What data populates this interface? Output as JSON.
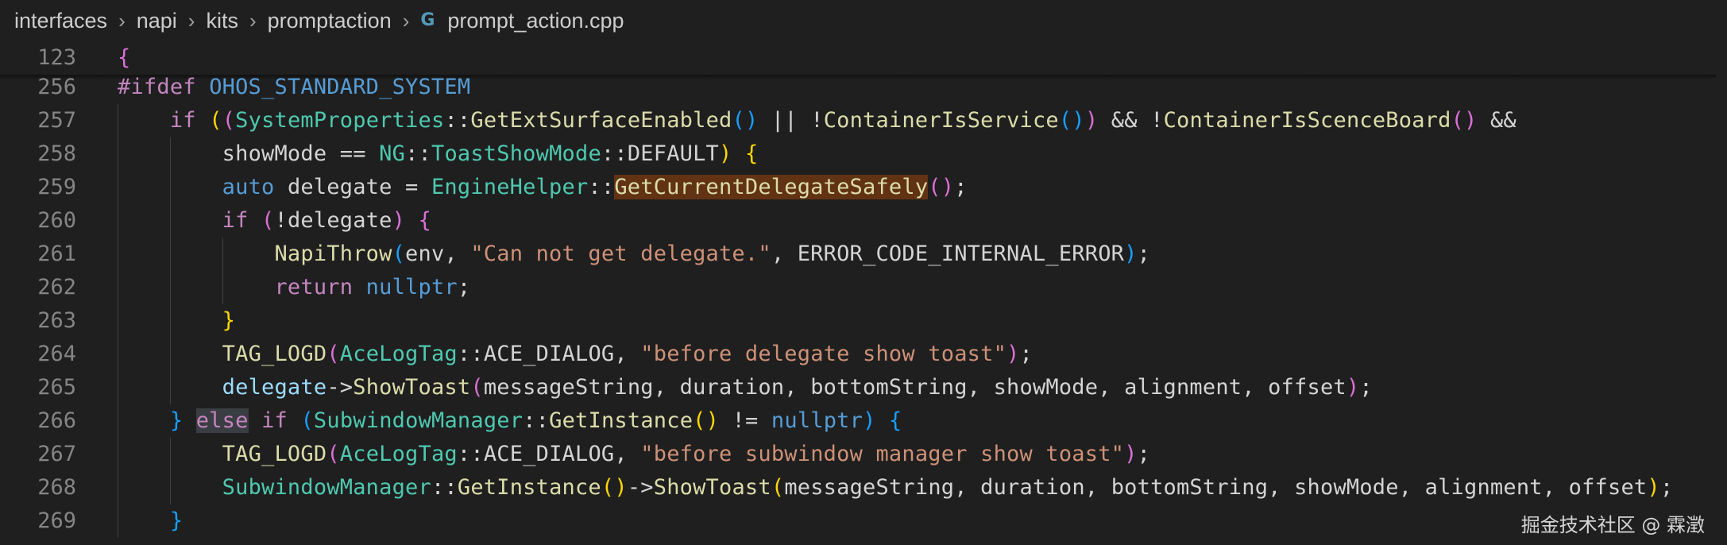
{
  "breadcrumb": {
    "parts": [
      "interfaces",
      "napi",
      "kits",
      "promptaction"
    ],
    "file_icon": "C-plus-plus-file-icon",
    "file": "prompt_action.cpp"
  },
  "sticky": {
    "lineno": "123",
    "text": "{"
  },
  "lines": [
    {
      "n": "256",
      "tokens": [
        [
          "#ifdef",
          "kw"
        ],
        [
          " OHOS_STANDARD_SYSTEM",
          "macro"
        ]
      ]
    },
    {
      "n": "257",
      "tokens": [
        [
          "    ",
          "plain"
        ],
        [
          "if",
          "kw"
        ],
        [
          " ",
          "plain"
        ],
        [
          "(",
          "br1"
        ],
        [
          "(",
          "br2"
        ],
        [
          "SystemProperties",
          "type"
        ],
        [
          "::",
          "op"
        ],
        [
          "GetExtSurfaceEnabled",
          "fn"
        ],
        [
          "()",
          "br3"
        ],
        [
          " || !",
          "op"
        ],
        [
          "ContainerIsService",
          "fn"
        ],
        [
          "()",
          "br3"
        ],
        [
          ")",
          "br2"
        ],
        [
          " && !",
          "op"
        ],
        [
          "ContainerIsScenceBoard",
          "fn"
        ],
        [
          "()",
          "br2"
        ],
        [
          " &&",
          "op"
        ]
      ]
    },
    {
      "n": "258",
      "tokens": [
        [
          "        ",
          "plain"
        ],
        [
          "showMode",
          "plain"
        ],
        [
          " == ",
          "op"
        ],
        [
          "NG",
          "type"
        ],
        [
          "::",
          "op"
        ],
        [
          "ToastShowMode",
          "type"
        ],
        [
          "::",
          "op"
        ],
        [
          "DEFAULT",
          "plain"
        ],
        [
          ")",
          "br1"
        ],
        [
          " ",
          "plain"
        ],
        [
          "{",
          "br1"
        ]
      ]
    },
    {
      "n": "259",
      "tokens": [
        [
          "        ",
          "plain"
        ],
        [
          "auto",
          "kw2"
        ],
        [
          " delegate = ",
          "plain"
        ],
        [
          "EngineHelper",
          "type"
        ],
        [
          "::",
          "op"
        ],
        [
          "GetCurrentDelegateSafely",
          "fn-hl"
        ],
        [
          "()",
          "br2"
        ],
        [
          ";",
          "plain"
        ]
      ]
    },
    {
      "n": "260",
      "tokens": [
        [
          "        ",
          "plain"
        ],
        [
          "if",
          "kw"
        ],
        [
          " ",
          "plain"
        ],
        [
          "(",
          "br2"
        ],
        [
          "!delegate",
          "plain"
        ],
        [
          ")",
          "br2"
        ],
        [
          " ",
          "plain"
        ],
        [
          "{",
          "br2"
        ]
      ]
    },
    {
      "n": "261",
      "tokens": [
        [
          "            ",
          "plain"
        ],
        [
          "NapiThrow",
          "fn"
        ],
        [
          "(",
          "br3"
        ],
        [
          "env, ",
          "plain"
        ],
        [
          "\"Can not get delegate.\"",
          "str"
        ],
        [
          ", ERROR_CODE_INTERNAL_ERROR",
          "plain"
        ],
        [
          ")",
          "br3"
        ],
        [
          ";",
          "plain"
        ]
      ]
    },
    {
      "n": "262",
      "tokens": [
        [
          "            ",
          "plain"
        ],
        [
          "return",
          "kw"
        ],
        [
          " ",
          "plain"
        ],
        [
          "nullptr",
          "kw2"
        ],
        [
          ";",
          "plain"
        ]
      ]
    },
    {
      "n": "263",
      "tokens": [
        [
          "        ",
          "plain"
        ],
        [
          "}",
          "br1"
        ]
      ]
    },
    {
      "n": "264",
      "tokens": [
        [
          "        ",
          "plain"
        ],
        [
          "TAG_LOGD",
          "fn"
        ],
        [
          "(",
          "br2"
        ],
        [
          "AceLogTag",
          "type"
        ],
        [
          "::",
          "op"
        ],
        [
          "ACE_DIALOG, ",
          "plain"
        ],
        [
          "\"before delegate show toast\"",
          "str"
        ],
        [
          ")",
          "br2"
        ],
        [
          ";",
          "plain"
        ]
      ]
    },
    {
      "n": "265",
      "tokens": [
        [
          "        ",
          "plain"
        ],
        [
          "delegate",
          "var"
        ],
        [
          "->",
          "op"
        ],
        [
          "ShowToast",
          "fn"
        ],
        [
          "(",
          "br2"
        ],
        [
          "messageString, duration, bottomString, showMode, alignment, offset",
          "plain"
        ],
        [
          ")",
          "br2"
        ],
        [
          ";",
          "plain"
        ]
      ]
    },
    {
      "n": "266",
      "tokens": [
        [
          "    ",
          "plain"
        ],
        [
          "}",
          "br3"
        ],
        [
          " ",
          "plain"
        ],
        [
          "else",
          "kw-hl"
        ],
        [
          " ",
          "plain"
        ],
        [
          "if",
          "kw"
        ],
        [
          " ",
          "plain"
        ],
        [
          "(",
          "br3"
        ],
        [
          "SubwindowManager",
          "type"
        ],
        [
          "::",
          "op"
        ],
        [
          "GetInstance",
          "fn"
        ],
        [
          "()",
          "br1"
        ],
        [
          " != ",
          "op"
        ],
        [
          "nullptr",
          "kw2"
        ],
        [
          ")",
          "br3"
        ],
        [
          " ",
          "plain"
        ],
        [
          "{",
          "br3"
        ]
      ]
    },
    {
      "n": "267",
      "tokens": [
        [
          "        ",
          "plain"
        ],
        [
          "TAG_LOGD",
          "fn"
        ],
        [
          "(",
          "br2"
        ],
        [
          "AceLogTag",
          "type"
        ],
        [
          "::",
          "op"
        ],
        [
          "ACE_DIALOG, ",
          "plain"
        ],
        [
          "\"before subwindow manager show toast\"",
          "str"
        ],
        [
          ")",
          "br2"
        ],
        [
          ";",
          "plain"
        ]
      ]
    },
    {
      "n": "268",
      "tokens": [
        [
          "        ",
          "plain"
        ],
        [
          "SubwindowManager",
          "type"
        ],
        [
          "::",
          "op"
        ],
        [
          "GetInstance",
          "fn"
        ],
        [
          "()",
          "br1"
        ],
        [
          "->",
          "op"
        ],
        [
          "ShowToast",
          "fn"
        ],
        [
          "(",
          "br1"
        ],
        [
          "messageString, duration, bottomString, showMode, alignment, offset",
          "plain"
        ],
        [
          ")",
          "br1"
        ],
        [
          ";",
          "plain"
        ]
      ]
    },
    {
      "n": "269",
      "tokens": [
        [
          "    ",
          "plain"
        ],
        [
          "}",
          "br3"
        ]
      ]
    }
  ],
  "watermark": "掘金技术社区 @ 霖澂"
}
